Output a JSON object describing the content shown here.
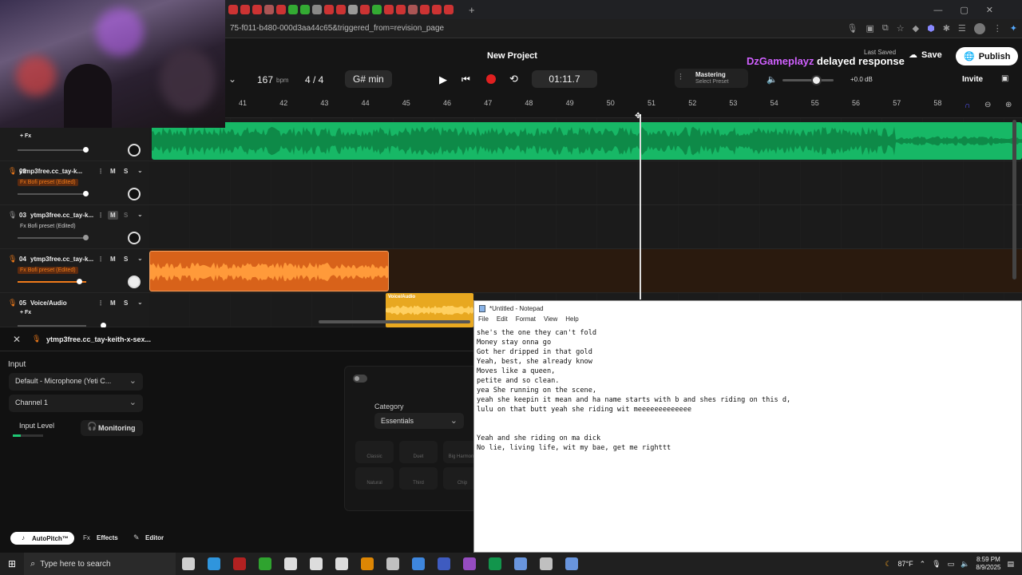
{
  "browser": {
    "url": "75-f011-b480-000d3aa44c65&triggered_from=revision_page"
  },
  "project": {
    "title": "New Project",
    "bpm_value": "167",
    "bpm_unit": "bpm",
    "time_signature": "4 / 4",
    "key": "G# min",
    "time": "01:11.7",
    "mastering_label": "Mastering",
    "mastering_preset": "Select Preset",
    "volume": "+0.0 dB",
    "last_saved": "Last Saved",
    "save_label": "Save",
    "publish_label": "Publish",
    "invite_label": "Invite"
  },
  "overlay": {
    "username": "DzGameplayz",
    "message": "delayed response"
  },
  "ruler": [
    "41",
    "42",
    "43",
    "44",
    "45",
    "46",
    "47",
    "48",
    "49",
    "50",
    "51",
    "52",
    "53",
    "54",
    "55",
    "56",
    "57",
    "58"
  ],
  "tracks": [
    {
      "number": "",
      "name": "",
      "fx": "+ Fx"
    },
    {
      "number": "02",
      "name": "ytmp3free.cc_tay-k...",
      "fx": "Fx Bofi preset (Edited)"
    },
    {
      "number": "03",
      "name": "ytmp3free.cc_tay-k...",
      "fx": "Fx Bofi preset (Edited)"
    },
    {
      "number": "04",
      "name": "ytmp3free.cc_tay-k...",
      "fx": "Fx Bofi preset (Edited)"
    },
    {
      "number": "05",
      "name": "Voice/Audio",
      "fx": "+ Fx"
    }
  ],
  "clip_label": "Voice/Audio",
  "track_controls": {
    "mute": "M",
    "solo": "S"
  },
  "panel": {
    "title": "ytmp3free.cc_tay-keith-x-sex...",
    "input_label": "Input",
    "input_device": "Default - Microphone (Yeti C...",
    "channel": "Channel 1",
    "input_level_label": "Input Level",
    "monitoring_label": "Monitoring",
    "category_label": "Category",
    "category_value": "Essentials",
    "tiles": [
      "Classic",
      "Duet",
      "Big Harmony",
      "Natural",
      "Third",
      "Chip"
    ],
    "tabs": [
      "AutoPitch™",
      "Effects",
      "Editor"
    ]
  },
  "notepad": {
    "title": "*Untitled - Notepad",
    "menu": [
      "File",
      "Edit",
      "Format",
      "View",
      "Help"
    ],
    "lines": [
      "she's the one they can't fold",
      "Money stay onna go",
      "Got her dripped in that gold",
      "Yeah, best, she already know",
      "Moves like a queen,",
      "petite and so clean.",
      "yea She running on the scene,",
      "yeah she keepin it mean and ha name starts with b and shes riding on this d,",
      "lulu on that butt yeah she riding wit meeeeeeeeeeeee",
      "",
      "",
      "Yeah and she riding on ma dick",
      "No lie, living life, wit my bae, get me righttt"
    ]
  },
  "taskbar": {
    "search_placeholder": "Type here to search",
    "weather": "87°F",
    "time": "8:59 PM",
    "date": "8/9/2025"
  },
  "colors": {
    "green": "#1ec773",
    "orange": "#f07a1a",
    "yellow": "#e8a820",
    "record": "#e02020",
    "notepad_bg": "#ffffff"
  }
}
